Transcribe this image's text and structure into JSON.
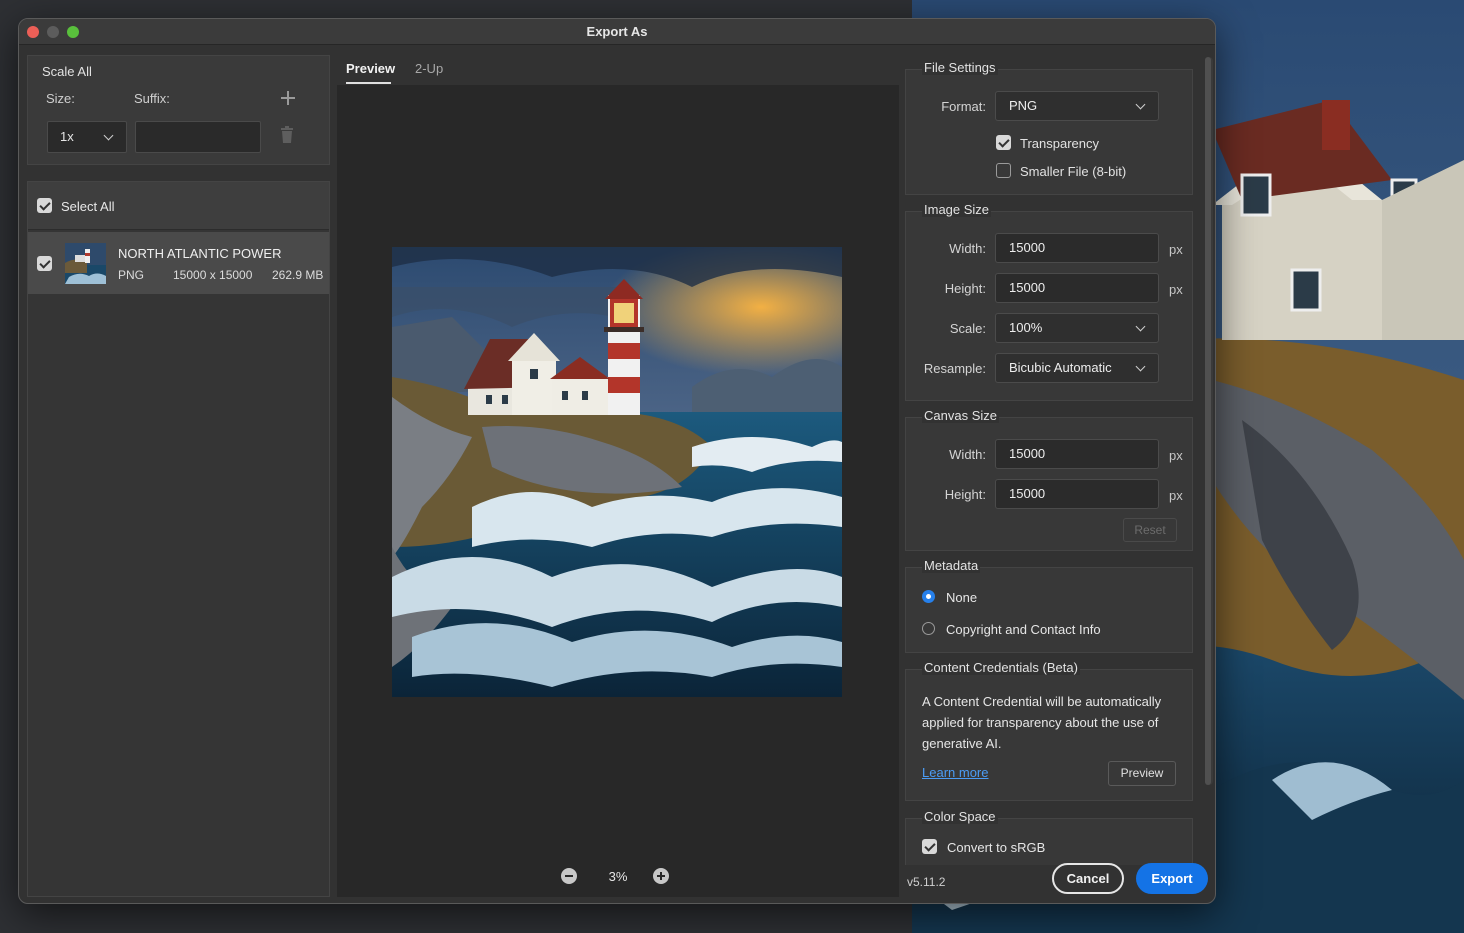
{
  "window": {
    "title": "Export As"
  },
  "scale_all": {
    "title": "Scale All",
    "size_label": "Size:",
    "suffix_label": "Suffix:",
    "size_value": "1x",
    "suffix_value": ""
  },
  "asset_list": {
    "select_all_label": "Select All",
    "items": [
      {
        "name": "NORTH ATLANTIC POWER",
        "format": "PNG",
        "dimensions": "15000 x 15000",
        "size": "262.9 MB"
      }
    ]
  },
  "preview": {
    "tabs": [
      {
        "label": "Preview"
      },
      {
        "label": "2-Up"
      }
    ],
    "zoom": "3%"
  },
  "file_settings": {
    "title": "File Settings",
    "format_label": "Format:",
    "format_value": "PNG",
    "transparency_label": "Transparency",
    "transparency_checked": true,
    "smaller_file_label": "Smaller File (8-bit)",
    "smaller_file_checked": false
  },
  "image_size": {
    "title": "Image Size",
    "width_label": "Width:",
    "width_value": "15000",
    "height_label": "Height:",
    "height_value": "15000",
    "scale_label": "Scale:",
    "scale_value": "100%",
    "resample_label": "Resample:",
    "resample_value": "Bicubic Automatic",
    "unit": "px"
  },
  "canvas_size": {
    "title": "Canvas Size",
    "width_label": "Width:",
    "width_value": "15000",
    "height_label": "Height:",
    "height_value": "15000",
    "unit": "px",
    "reset_label": "Reset"
  },
  "metadata": {
    "title": "Metadata",
    "options": [
      {
        "label": "None",
        "selected": true
      },
      {
        "label": "Copyright and Contact Info",
        "selected": false
      }
    ]
  },
  "content_credentials": {
    "title": "Content Credentials (Beta)",
    "description_lines": [
      "A Content Credential will be automatically",
      "applied for transparency about the use of",
      "generative AI."
    ],
    "learn_more_label": "Learn more",
    "preview_button_label": "Preview"
  },
  "color_space": {
    "title": "Color Space",
    "convert_label": "Convert to sRGB",
    "convert_checked": true
  },
  "footer": {
    "version": "v5.11.2",
    "cancel_label": "Cancel",
    "export_label": "Export"
  },
  "colors": {
    "accent": "#1473e6",
    "radio_selected": "#2680eb",
    "link": "#4b9cf5"
  }
}
